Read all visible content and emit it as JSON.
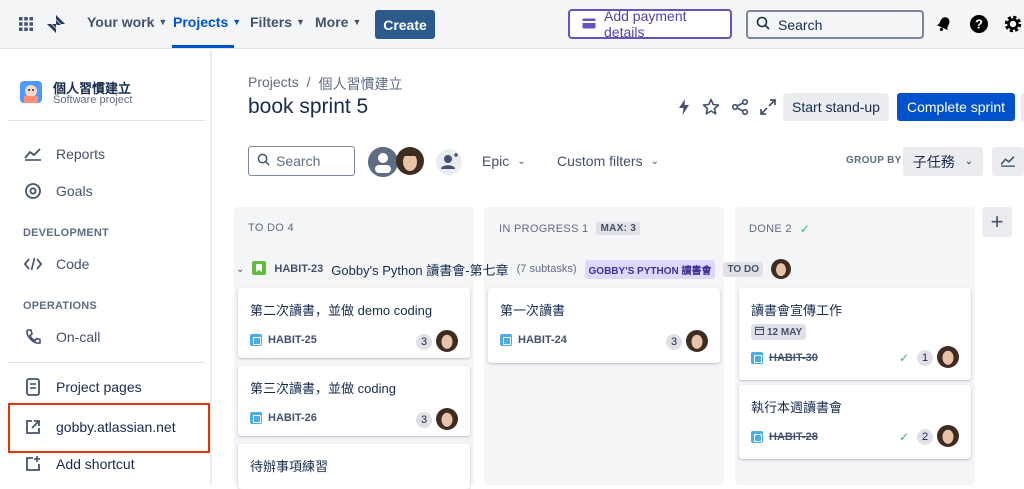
{
  "topbar": {
    "nav": [
      "Your work",
      "Projects",
      "Filters",
      "More"
    ],
    "create_label": "Create",
    "payment_label": "Add payment details",
    "search_placeholder": "Search"
  },
  "sidebar": {
    "project_name": "個人習慣建立",
    "project_type": "Software project",
    "items_top": [
      "Reports",
      "Goals"
    ],
    "development_heading": "DEVELOPMENT",
    "development_items": [
      "Code"
    ],
    "operations_heading": "OPERATIONS",
    "operations_items": [
      "On-call"
    ],
    "project_pages": "Project pages",
    "external_link": "gobby.atlassian.net",
    "add_shortcut": "Add shortcut"
  },
  "header": {
    "breadcrumb": [
      "Projects",
      "/",
      "個人習慣建立"
    ],
    "title": "book sprint 5",
    "standup_label": "Start stand-up",
    "complete_label": "Complete sprint"
  },
  "filters": {
    "search_placeholder": "Search",
    "epic_label": "Epic",
    "custom_label": "Custom filters",
    "group_by_label": "GROUP BY",
    "group_by_value": "子任務"
  },
  "columns": [
    {
      "title": "TO DO 4",
      "badge": ""
    },
    {
      "title": "IN PROGRESS 1",
      "badge": "MAX: 3"
    },
    {
      "title": "DONE 2",
      "badge": ""
    }
  ],
  "swimlane": {
    "key": "HABIT-23",
    "title": "Gobby's Python 讀書會-第七章",
    "subtasks": "(7 subtasks)",
    "epic": "GOBBY'S PYTHON 讀書會",
    "status": "TO DO"
  },
  "cards": {
    "todo": [
      {
        "title": "第二次讀書，並做 demo coding",
        "key": "HABIT-25",
        "count": "3"
      },
      {
        "title": "第三次讀書，並做 coding",
        "key": "HABIT-26",
        "count": "3"
      },
      {
        "title": "待辦事項練習",
        "key": "",
        "count": ""
      }
    ],
    "inprogress": [
      {
        "title": "第一次讀書",
        "key": "HABIT-24",
        "count": "3"
      }
    ],
    "done": [
      {
        "title": "讀書會宣傳工作",
        "date": "12 MAY",
        "key": "HABIT-30",
        "count": "1"
      },
      {
        "title": "執行本週讀書會",
        "key": "HABIT-28",
        "count": "2"
      }
    ]
  },
  "colors": {
    "accent": "#0052cc",
    "highlight": "#de350b",
    "purple": "#6554c0"
  }
}
